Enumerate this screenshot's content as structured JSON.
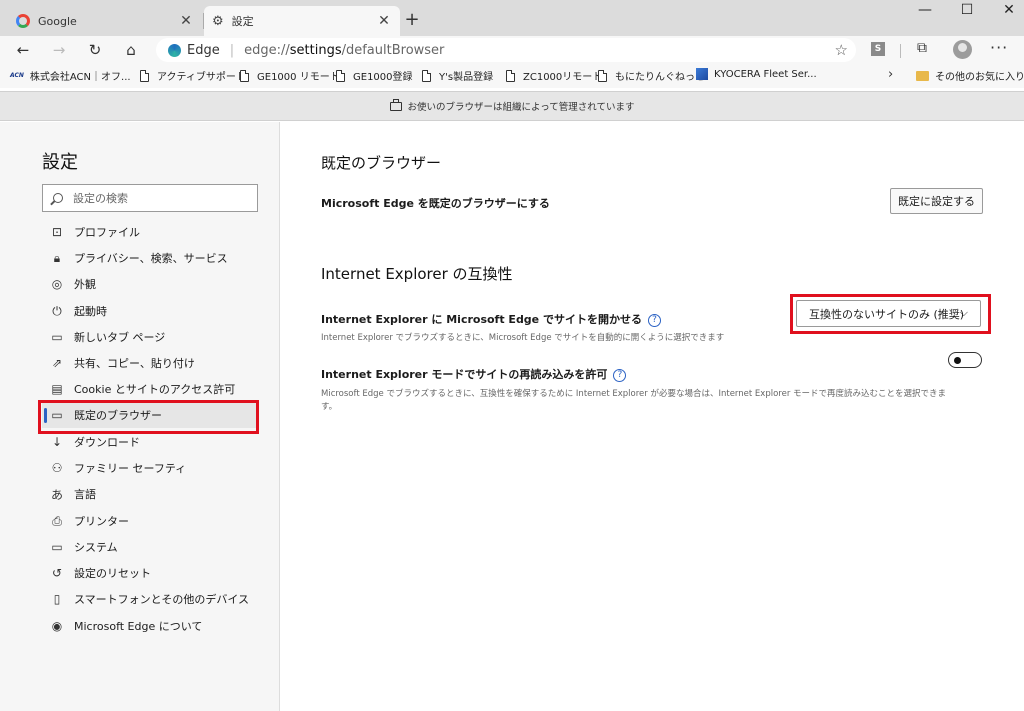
{
  "tabs": [
    {
      "title": "Google",
      "icon": "google-icon"
    },
    {
      "title": "設定",
      "icon": "gear-icon"
    }
  ],
  "window_controls": {
    "minimize": "—",
    "maximize": "☐",
    "close": "✕"
  },
  "address": {
    "brand": "Edge",
    "url_prefix": "edge://",
    "url_bold": "settings",
    "url_suffix": "/defaultBrowser"
  },
  "toolbar": {
    "extension_label": "S"
  },
  "favorites": [
    {
      "label": "株式会社ACN｜オフ...",
      "icon": "acn-logo",
      "logo_text": "ACN"
    },
    {
      "label": "アクティブサポート",
      "icon": "page-icon"
    },
    {
      "label": "GE1000 リモート",
      "icon": "page-icon"
    },
    {
      "label": "GE1000登録",
      "icon": "page-icon"
    },
    {
      "label": "Y's製品登録",
      "icon": "page-icon"
    },
    {
      "label": "ZC1000リモート",
      "icon": "page-icon"
    },
    {
      "label": "もにたりんぐねっと",
      "icon": "page-icon"
    },
    {
      "label": "KYOCERA Fleet Ser...",
      "icon": "kyocera-icon"
    }
  ],
  "favorites_other": "その他のお気に入り",
  "banner": {
    "text": "お使いのブラウザーは組織によって管理されています"
  },
  "sidebar": {
    "title": "設定",
    "search_placeholder": "設定の検索",
    "items": [
      {
        "label": "プロファイル",
        "icon": "profile-icon"
      },
      {
        "label": "プライバシー、検索、サービス",
        "icon": "lock-icon"
      },
      {
        "label": "外観",
        "icon": "palette-icon"
      },
      {
        "label": "起動時",
        "icon": "power-icon"
      },
      {
        "label": "新しいタブ ページ",
        "icon": "newtab-icon"
      },
      {
        "label": "共有、コピー、貼り付け",
        "icon": "share-icon"
      },
      {
        "label": "Cookie とサイトのアクセス許可",
        "icon": "cookie-icon"
      },
      {
        "label": "既定のブラウザー",
        "icon": "browser-icon",
        "active": true
      },
      {
        "label": "ダウンロード",
        "icon": "download-icon"
      },
      {
        "label": "ファミリー セーフティ",
        "icon": "family-icon"
      },
      {
        "label": "言語",
        "icon": "language-icon"
      },
      {
        "label": "プリンター",
        "icon": "printer-icon"
      },
      {
        "label": "システム",
        "icon": "system-icon"
      },
      {
        "label": "設定のリセット",
        "icon": "reset-icon"
      },
      {
        "label": "スマートフォンとその他のデバイス",
        "icon": "phone-icon"
      },
      {
        "label": "Microsoft Edge について",
        "icon": "edge-icon"
      }
    ]
  },
  "main": {
    "default_browser": {
      "heading": "既定のブラウザー",
      "row_label": "Microsoft Edge を既定のブラウザーにする",
      "button_label": "既定に設定する"
    },
    "ie_compat": {
      "heading": "Internet Explorer の互換性",
      "open_sites_label": "Internet Explorer に Microsoft Edge でサイトを開かせる",
      "open_sites_desc": "Internet Explorer でブラウズするときに、Microsoft Edge でサイトを自動的に開くように選択できます",
      "dropdown_value": "互換性のないサイトのみ (推奨)",
      "reload_label": "Internet Explorer モードでサイトの再読み込みを許可",
      "reload_desc": "Microsoft Edge でブラウズするときに、互換性を確保するために Internet Explorer が必要な場合は、Internet Explorer モードで再度読み込むことを選択できます。",
      "reload_enabled": false
    }
  },
  "colors": {
    "highlight_border": "#e0101e",
    "accent": "#2b62c4"
  }
}
